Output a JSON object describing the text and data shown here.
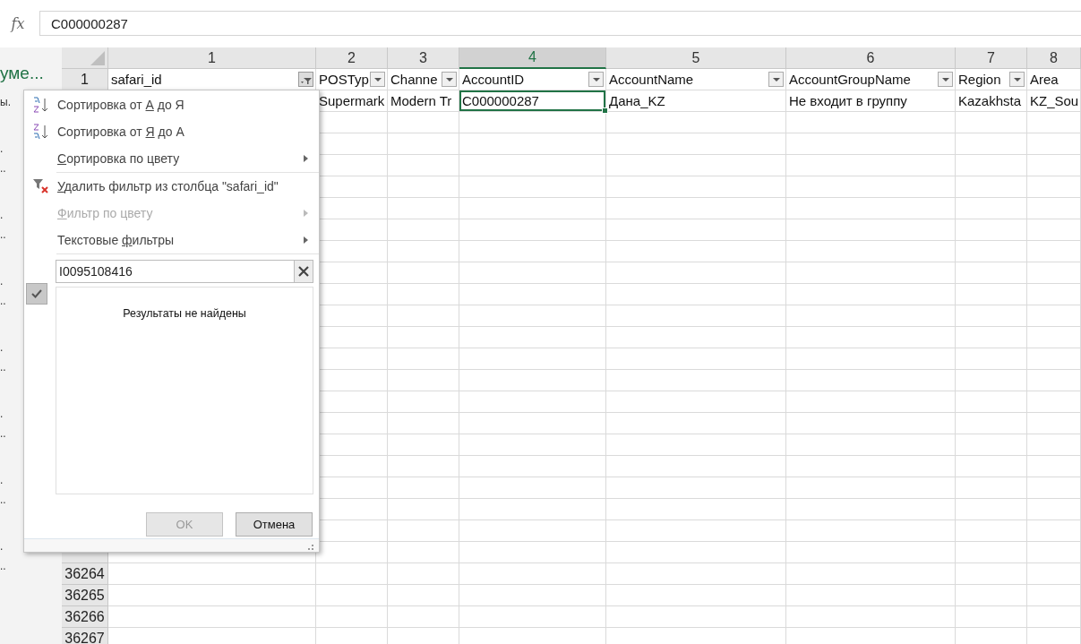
{
  "formula_bar": {
    "label": "fx",
    "value": "C000000287"
  },
  "side_pane": {
    "title": "уме...",
    "fragments": [
      "ы.",
      ".",
      "..",
      ".",
      "..",
      ".",
      "..",
      ".",
      "..",
      ".",
      "..",
      ".",
      "..",
      ".",
      ".."
    ]
  },
  "columns": [
    {
      "number": "1",
      "header": "safari_id",
      "filtered": true,
      "selected": false
    },
    {
      "number": "2",
      "header": "POSTyp",
      "filtered": false,
      "selected": false
    },
    {
      "number": "3",
      "header": "Channe",
      "filtered": false,
      "selected": false
    },
    {
      "number": "4",
      "header": "AccountID",
      "filtered": false,
      "selected": true
    },
    {
      "number": "5",
      "header": "AccountName",
      "filtered": false,
      "selected": false
    },
    {
      "number": "6",
      "header": "AccountGroupName",
      "filtered": false,
      "selected": false
    },
    {
      "number": "7",
      "header": "Region",
      "filtered": false,
      "selected": false
    },
    {
      "number": "8",
      "header": "Area",
      "selected": false
    }
  ],
  "rows": [
    {
      "number": "1"
    },
    {
      "cells": [
        {
          "text": "Supermark",
          "selected": false
        },
        {
          "text": "Modern Tr",
          "selected": false
        },
        {
          "text": "C000000287",
          "selected": true
        },
        {
          "text": "Дана_KZ",
          "selected": false
        },
        {
          "text": "Не входит в группу",
          "selected": false
        },
        {
          "text": "Kazakhsta",
          "selected": false
        },
        {
          "text": "KZ_Sou",
          "selected": false
        }
      ]
    },
    {},
    {},
    {},
    {},
    {},
    {},
    {},
    {},
    {},
    {},
    {},
    {},
    {},
    {},
    {},
    {},
    {},
    {},
    {},
    {},
    {},
    {
      "number": "36264"
    },
    {
      "number": "36265"
    },
    {
      "number": "36266"
    },
    {
      "number": "36267"
    }
  ],
  "filter_menu": {
    "items": [
      {
        "kind": "sort-asc",
        "before": "Сортировка от ",
        "key": "А",
        "after": " до Я",
        "disabled": false,
        "submenu": false
      },
      {
        "kind": "sort-desc",
        "before": "Сортировка от ",
        "key": "Я",
        "after": " до А",
        "disabled": false,
        "submenu": false
      },
      {
        "kind": "plain",
        "key": "С",
        "after": "ортировка по цвету",
        "disabled": false,
        "submenu": true
      },
      {
        "kind": "separator"
      },
      {
        "kind": "clear-filter",
        "key": "У",
        "after": "далить фильтр из столбца \"safari_id\"",
        "disabled": false,
        "submenu": false
      },
      {
        "kind": "plain",
        "key": "Ф",
        "after": "ильтр по цвету",
        "disabled": true,
        "submenu": true
      },
      {
        "kind": "plain",
        "before": "Текстовые ",
        "key": "ф",
        "after": "ильтры",
        "disabled": false,
        "submenu": true
      },
      {
        "kind": "separator"
      }
    ],
    "search": {
      "value": "I0095108416"
    },
    "select_all_checked": true,
    "empty_message": "Результаты не найдены",
    "buttons": [
      {
        "label": "OK",
        "disabled": true
      },
      {
        "label": "Отмена",
        "disabled": false
      }
    ]
  }
}
